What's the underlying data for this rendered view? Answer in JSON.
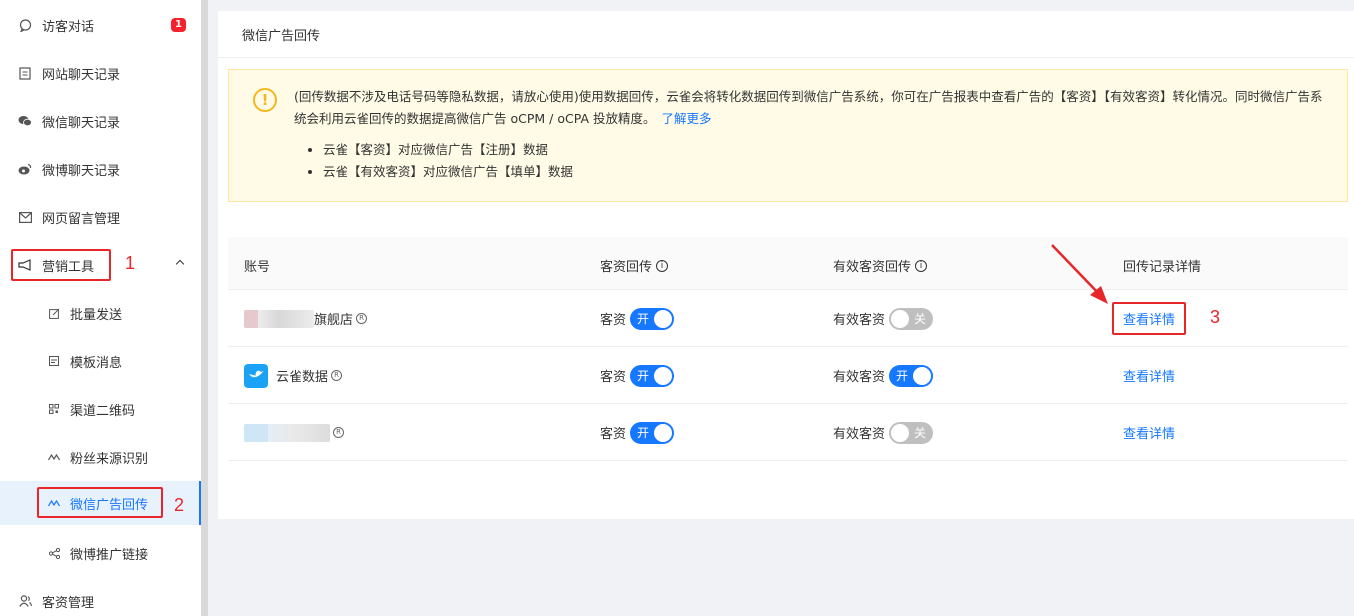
{
  "sidebar": {
    "items": [
      {
        "label": "访客对话",
        "icon": "chat-bubble-icon",
        "badge": "1"
      },
      {
        "label": "网站聊天记录",
        "icon": "document-icon"
      },
      {
        "label": "微信聊天记录",
        "icon": "wechat-icon"
      },
      {
        "label": "微博聊天记录",
        "icon": "weibo-icon"
      },
      {
        "label": "网页留言管理",
        "icon": "mail-icon"
      },
      {
        "label": "营销工具",
        "icon": "megaphone-icon",
        "expanded": true
      },
      {
        "label": "批量发送",
        "icon": "edit-icon"
      },
      {
        "label": "模板消息",
        "icon": "template-icon"
      },
      {
        "label": "渠道二维码",
        "icon": "qrcode-icon"
      },
      {
        "label": "粉丝来源识别",
        "icon": "wave-icon"
      },
      {
        "label": "微信广告回传",
        "icon": "wave-icon",
        "active": true
      },
      {
        "label": "微博推广链接",
        "icon": "share-icon"
      },
      {
        "label": "客资管理",
        "icon": "users-icon"
      }
    ]
  },
  "annotations": [
    "1",
    "2",
    "3"
  ],
  "panel": {
    "title": "微信广告回传",
    "notice": {
      "text": "(回传数据不涉及电话号码等隐私数据，请放心使用)使用数据回传，云雀会将转化数据回传到微信广告系统，你可在广告报表中查看广告的【客资】【有效客资】转化情况。同时微信广告系统会利用云雀回传的数据提高微信广告 oCPM / oCPA 投放精度。",
      "link": "了解更多",
      "bullets": [
        "云雀【客资】对应微信广告【注册】数据",
        "云雀【有效客资】对应微信广告【填单】数据"
      ]
    },
    "table": {
      "headers": [
        "账号",
        "客资回传",
        "有效客资回传",
        "回传记录详情"
      ],
      "rows": [
        {
          "account": "旗舰店",
          "lead_label": "客资",
          "lead_switch": "开",
          "lead_on": true,
          "valid_label": "有效客资",
          "valid_switch": "关",
          "valid_on": false,
          "detail": "查看详情"
        },
        {
          "account": "云雀数据",
          "lead_label": "客资",
          "lead_switch": "开",
          "lead_on": true,
          "valid_label": "有效客资",
          "valid_switch": "开",
          "valid_on": true,
          "detail": "查看详情"
        },
        {
          "account": "",
          "lead_label": "客资",
          "lead_switch": "开",
          "lead_on": true,
          "valid_label": "有效客资",
          "valid_switch": "关",
          "valid_on": false,
          "detail": "查看详情"
        }
      ]
    }
  },
  "colors": {
    "accent": "#1677ff",
    "annotation": "#e8262a",
    "notice_bg": "#fffbe6"
  }
}
